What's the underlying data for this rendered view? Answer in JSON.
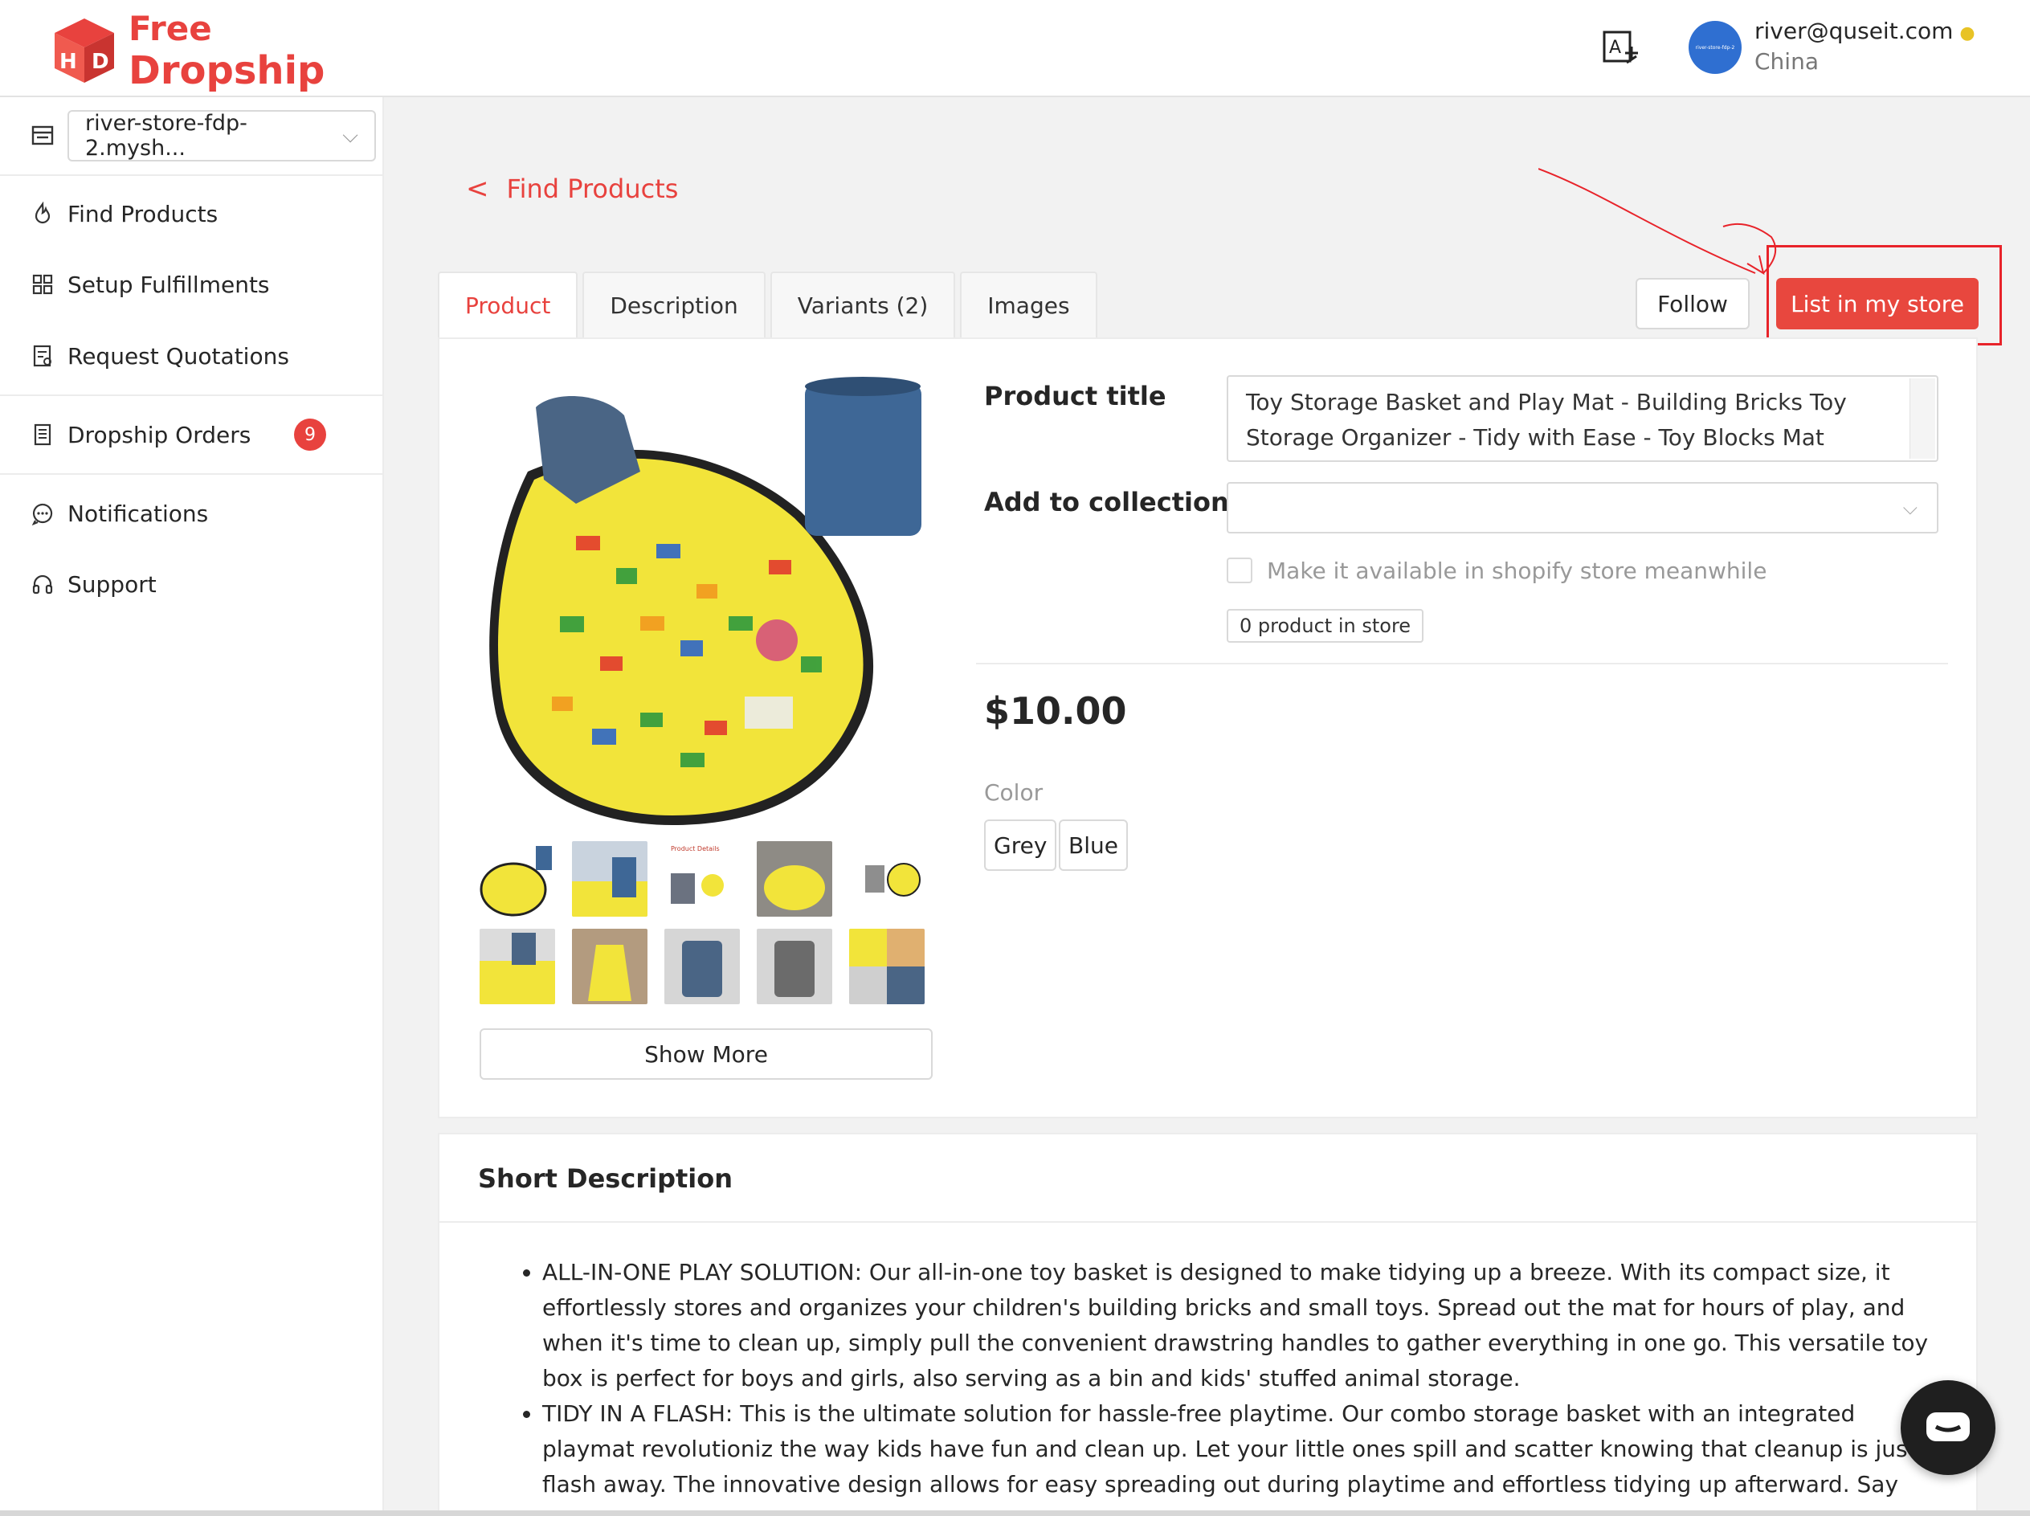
{
  "brand": {
    "line1": "Free",
    "line2": "Dropship",
    "color": "#e8423e"
  },
  "user": {
    "email": "river@quseit.com",
    "country": "China",
    "avatar_text": "river-store-fdp-2"
  },
  "sidebar": {
    "store_select": "river-store-fdp-2.mysh...",
    "items": [
      {
        "label": "Find Products",
        "icon": "flame-icon"
      },
      {
        "label": "Setup Fulfillments",
        "icon": "grid-icon"
      },
      {
        "label": "Request Quotations",
        "icon": "quotation-icon"
      },
      {
        "label": "Dropship Orders",
        "icon": "orders-icon",
        "badge": "9"
      },
      {
        "label": "Notifications",
        "icon": "chat-icon"
      },
      {
        "label": "Support",
        "icon": "headset-icon"
      }
    ]
  },
  "breadcrumb": {
    "back_label": "Find Products"
  },
  "tabs": [
    {
      "label": "Product",
      "active": true
    },
    {
      "label": "Description"
    },
    {
      "label": "Variants (2)"
    },
    {
      "label": "Images"
    }
  ],
  "actions": {
    "follow": "Follow",
    "list": "List in my store",
    "accent": "#e8473e"
  },
  "product": {
    "title_label": "Product title",
    "title_value": "Toy Storage Basket and Play Mat - Building Bricks Toy Storage Organizer - Tidy with Ease - Toy Blocks Mat Storage Bag -",
    "collection_label": "Add to collection",
    "checkbox_label": "Make it available in shopify store meanwhile",
    "store_count": "0 product in store",
    "price": "$10.00",
    "color_label": "Color",
    "colors": [
      "Grey",
      "Blue"
    ],
    "show_more": "Show More"
  },
  "short_description": {
    "title": "Short Description",
    "items": [
      "ALL-IN-ONE PLAY SOLUTION: Our all-in-one toy basket is designed to make tidying up a breeze. With its compact size, it effortlessly stores and organizes your children's building bricks and small toys. Spread out the mat for hours of play, and when it's time to clean up, simply pull the convenient drawstring handles to gather everything in one go. This versatile toy box is perfect for boys and girls, also serving as a bin and kids' stuffed animal storage.",
      "TIDY IN A FLASH: This is the ultimate solution for hassle-free playtime. Our combo storage basket with an integrated playmat revolutioniz the way kids have fun and clean up. Let your little ones spill and scatter knowing that cleanup is just a flash away. The innovative design allows for easy spreading out during playtime and effortless tidying up afterward. Say goodbye to tedious toy pick-ups; giving you more"
    ]
  }
}
